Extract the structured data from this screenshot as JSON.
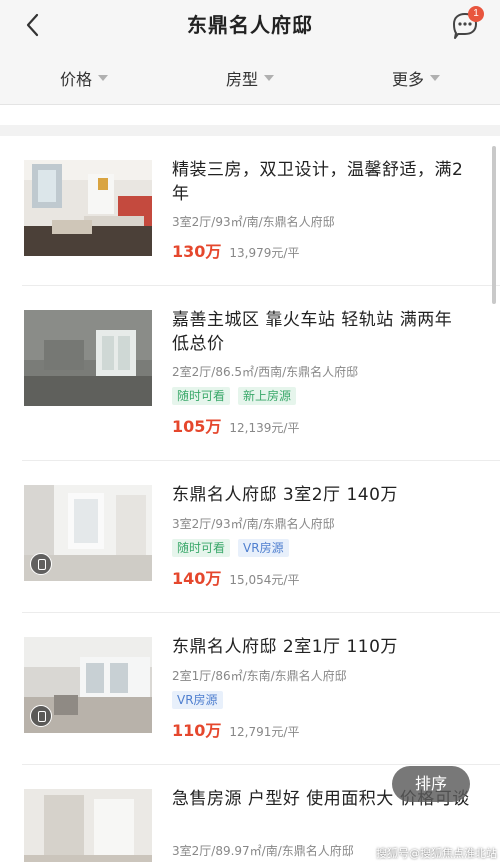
{
  "header": {
    "title": "东鼎名人府邸",
    "message_badge": "1"
  },
  "filters": [
    {
      "label": "价格"
    },
    {
      "label": "房型"
    },
    {
      "label": "更多"
    }
  ],
  "listings": [
    {
      "title": "精装三房，双卫设计，温馨舒适，满2年",
      "meta": "3室2厅/93㎡/南/东鼎名人府邸",
      "tags": [],
      "price": "130万",
      "unit_price": "13,979元/平",
      "vr": false
    },
    {
      "title": "嘉善主城区 靠火车站 轻轨站 满两年 低总价",
      "meta": "2室2厅/86.5㎡/西南/东鼎名人府邸",
      "tags": [
        {
          "label": "随时可看",
          "kind": "green"
        },
        {
          "label": "新上房源",
          "kind": "green"
        }
      ],
      "price": "105万",
      "unit_price": "12,139元/平",
      "vr": false
    },
    {
      "title": "东鼎名人府邸 3室2厅 140万",
      "meta": "3室2厅/93㎡/南/东鼎名人府邸",
      "tags": [
        {
          "label": "随时可看",
          "kind": "green"
        },
        {
          "label": "VR房源",
          "kind": "blue"
        }
      ],
      "price": "140万",
      "unit_price": "15,054元/平",
      "vr": true
    },
    {
      "title": "东鼎名人府邸 2室1厅 110万",
      "meta": "2室1厅/86㎡/东南/东鼎名人府邸",
      "tags": [
        {
          "label": "VR房源",
          "kind": "blue"
        }
      ],
      "price": "110万",
      "unit_price": "12,791元/平",
      "vr": true
    },
    {
      "title": "急售房源 户型好 使用面积大 价格可谈",
      "meta": "3室2厅/89.97㎡/南/东鼎名人府邸",
      "tags": [],
      "price": "",
      "unit_price": "",
      "vr": false
    }
  ],
  "sort_button": "排序",
  "watermark": "搜狐号@搜狐焦点淮北站",
  "colors": {
    "price": "#e5472d",
    "tag_green": "#3aa86a",
    "tag_blue": "#4f7fcf",
    "badge": "#e8553e"
  }
}
